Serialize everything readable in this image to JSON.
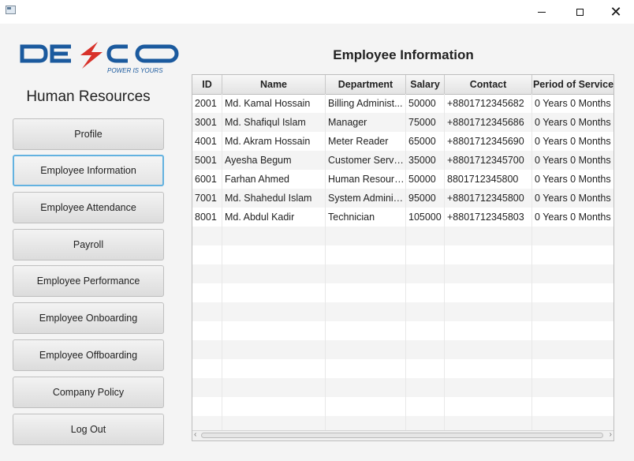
{
  "window": {
    "min_icon": "minimize-icon",
    "max_icon": "maximize-icon",
    "close_icon": "close-icon",
    "close_glyph": "✕"
  },
  "logo": {
    "text": "DESCO",
    "tagline": "POWER IS YOURS",
    "colors": {
      "blue": "#1b5a9e",
      "red": "#d8322a"
    }
  },
  "sidebar": {
    "title": "Human Resources",
    "items": [
      {
        "label": "Profile"
      },
      {
        "label": "Employee Information",
        "active": true
      },
      {
        "label": "Employee Attendance"
      },
      {
        "label": "Payroll"
      },
      {
        "label": "Employee Performance"
      },
      {
        "label": "Employee Onboarding"
      },
      {
        "label": "Employee Offboarding"
      },
      {
        "label": "Company Policy"
      },
      {
        "label": "Log Out"
      }
    ]
  },
  "main": {
    "title": "Employee Information",
    "columns": [
      "ID",
      "Name",
      "Department",
      "Salary",
      "Contact",
      "Period of Service"
    ],
    "rows": [
      [
        "2001",
        "Md. Kamal Hossain",
        "Billing Administ...",
        "50000",
        "+8801712345682",
        "0 Years 0 Months"
      ],
      [
        "3001",
        "Md. Shafiqul Islam",
        "Manager",
        "75000",
        "+8801712345686",
        "0 Years 0 Months"
      ],
      [
        "4001",
        "Md. Akram Hossain",
        "Meter Reader",
        "65000",
        "+8801712345690",
        "0 Years 0 Months"
      ],
      [
        "5001",
        "Ayesha Begum",
        "Customer Servic...",
        "35000",
        "+8801712345700",
        "0 Years 0 Months"
      ],
      [
        "6001",
        "Farhan Ahmed",
        "Human Resources",
        "50000",
        "8801712345800",
        "0 Years 0 Months"
      ],
      [
        "7001",
        "Md. Shahedul Islam",
        "System Adminis...",
        "95000",
        "+8801712345800",
        "0 Years 0 Months"
      ],
      [
        "8001",
        "Md. Abdul Kadir",
        "Technician",
        "105000",
        "+8801712345803",
        "0 Years 0 Months"
      ]
    ],
    "empty_rows": 11
  },
  "colors": {
    "accent_focus": "#63b2e0",
    "table_alt_row": "#f4f4f4"
  }
}
